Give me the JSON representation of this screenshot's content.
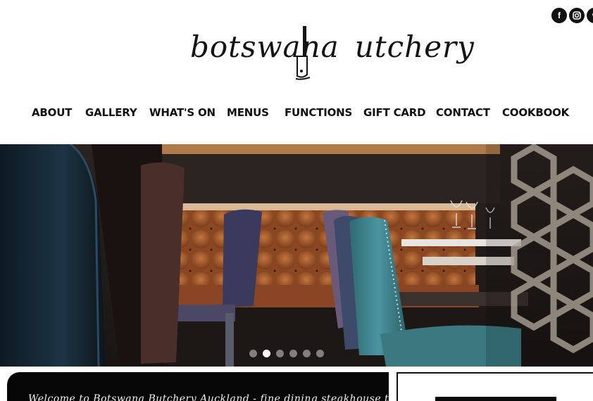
{
  "social": {
    "icons": [
      "facebook-icon",
      "instagram-icon",
      "vimeo-icon"
    ],
    "facebook_glyph": "f",
    "vimeo_glyph": "v"
  },
  "logo": {
    "part1": "botswana",
    "part2": "utchery"
  },
  "nav": {
    "items": [
      "ABOUT",
      "GALLERY",
      "WHAT'S ON",
      "MENUS",
      "FUNCTIONS",
      "GIFT CARD",
      "CONTACT",
      "COOKBOOK"
    ]
  },
  "hero": {
    "slide_count": 6,
    "active_slide": 2
  },
  "welcome": {
    "text": "Welcome to Botswana Butchery Auckland - fine dining steakhouse that"
  },
  "colors": {
    "leather": "#a4582a",
    "teal": "#3e7f86",
    "dark": "#1b1412",
    "accent": "#111111"
  }
}
